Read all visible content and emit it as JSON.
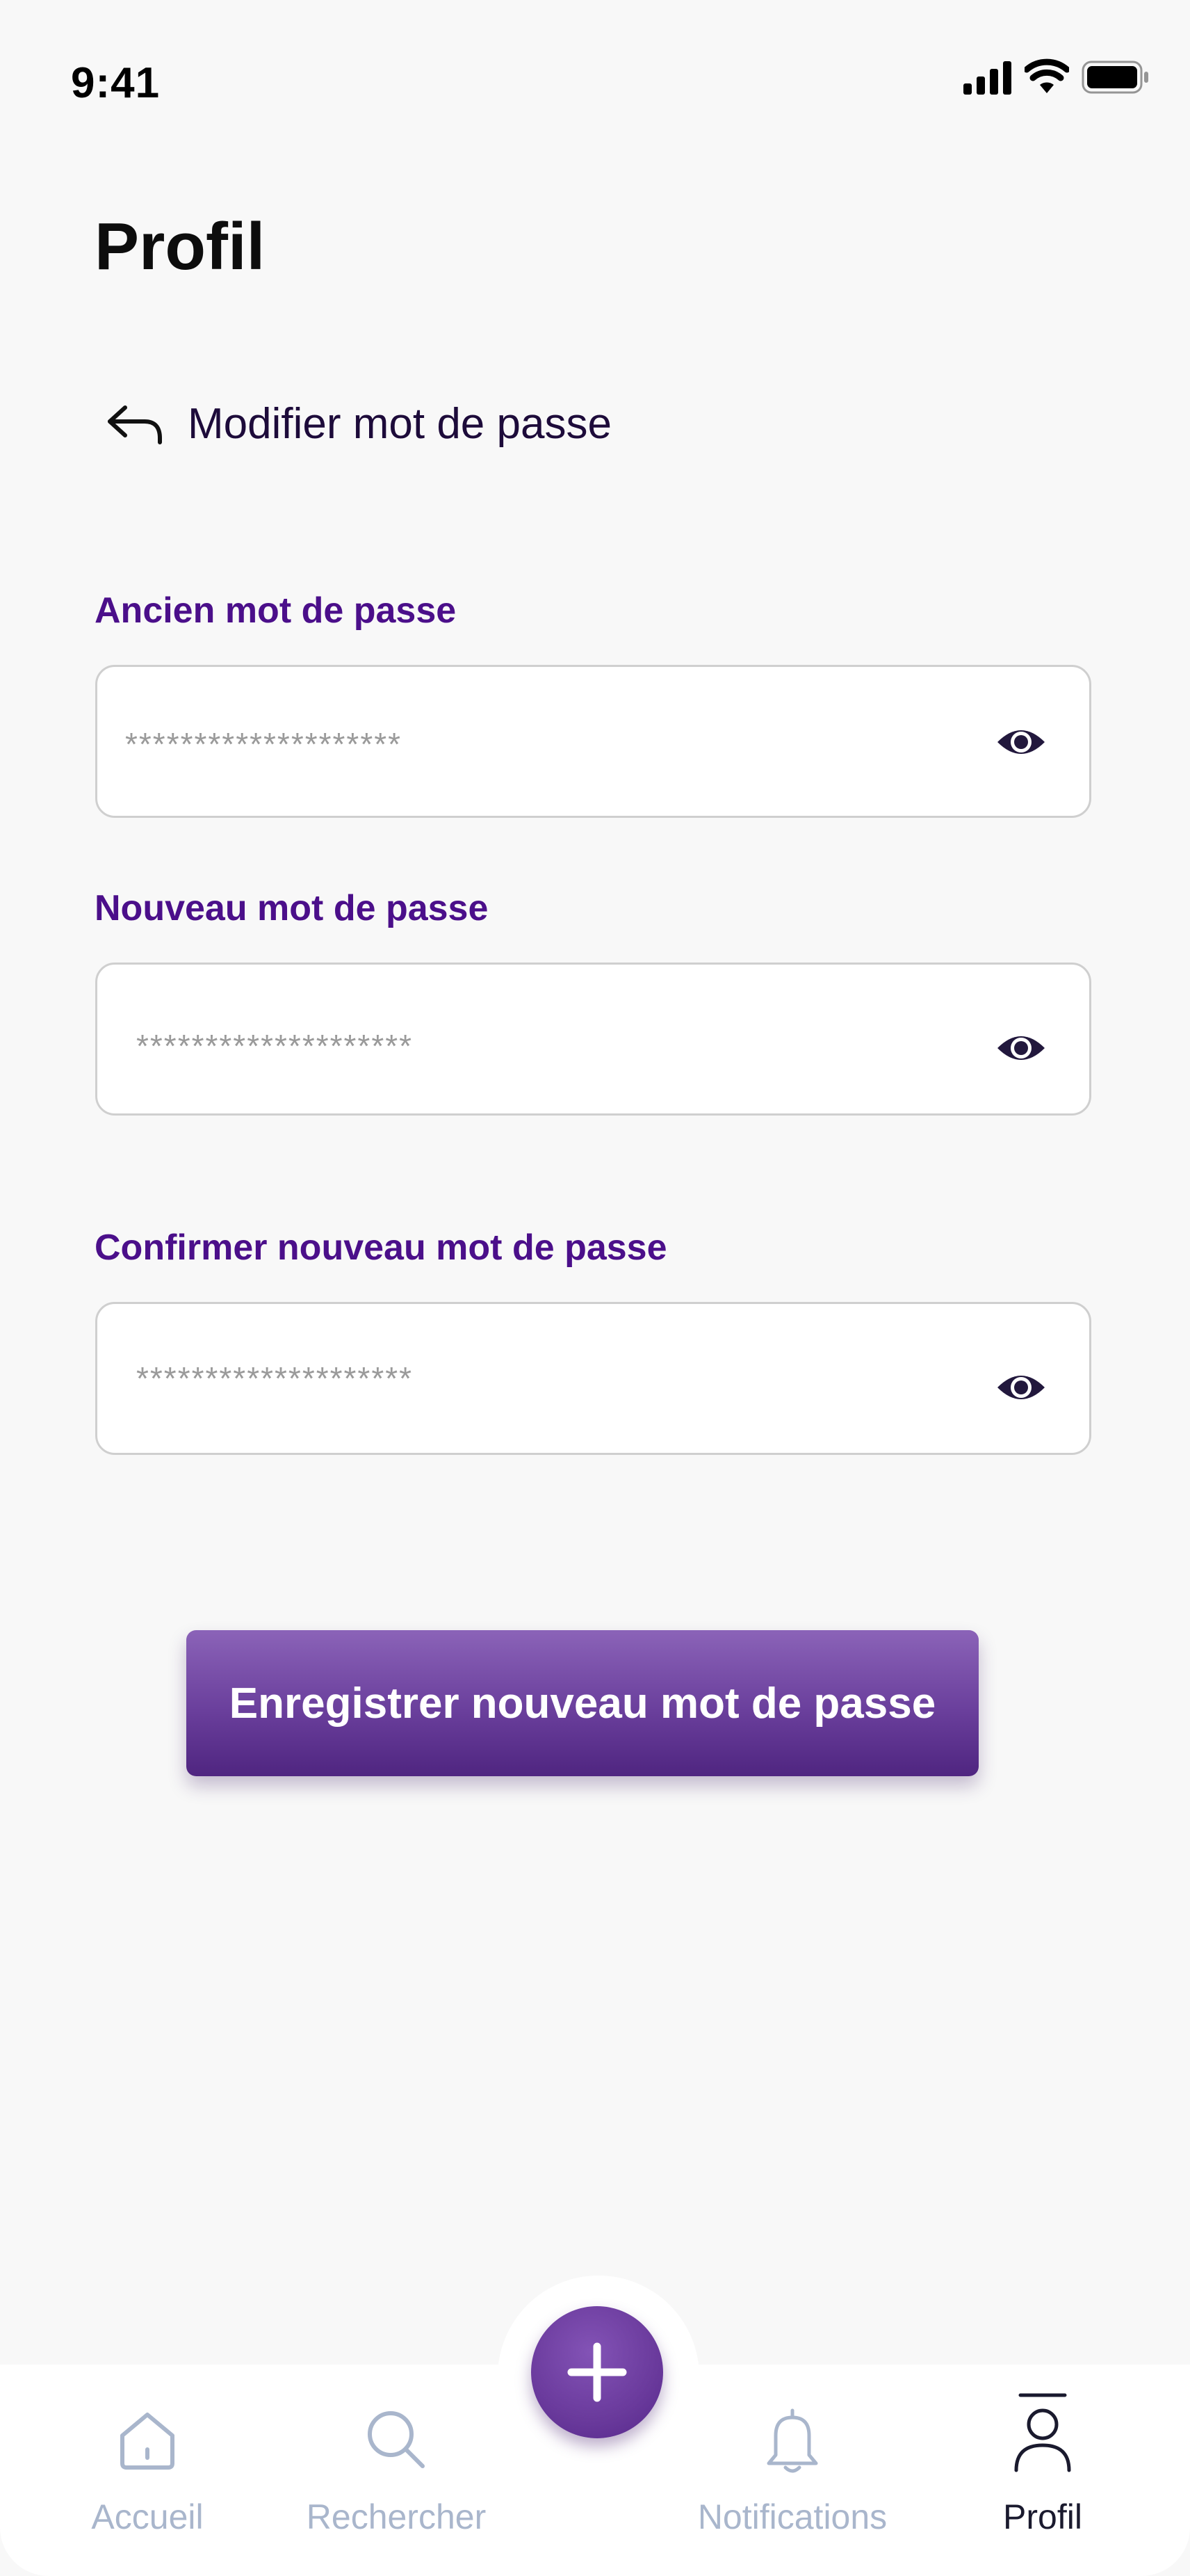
{
  "status_bar": {
    "time": "9:41",
    "icons": [
      "cellular-signal-icon",
      "wifi-icon",
      "battery-icon"
    ]
  },
  "header": {
    "title": "Profil"
  },
  "back": {
    "label": "Modifier mot de passe",
    "icon": "back-arrow-icon"
  },
  "form": {
    "fields": [
      {
        "label": "Ancien mot de passe",
        "value": "********************",
        "icon": "eye-icon"
      },
      {
        "label": "Nouveau mot de passe",
        "value": "********************",
        "icon": "eye-icon"
      },
      {
        "label": "Confirmer nouveau mot de passe",
        "value": "********************",
        "icon": "eye-icon"
      }
    ],
    "submit_label": "Enregistrer nouveau mot de passe"
  },
  "bottom_nav": {
    "items": [
      {
        "label": "Accueil",
        "icon": "home-icon",
        "active": false
      },
      {
        "label": "Rechercher",
        "icon": "search-icon",
        "active": false
      },
      {
        "label": "Notifications",
        "icon": "bell-icon",
        "active": false
      },
      {
        "label": "Profil",
        "icon": "user-icon",
        "active": true
      }
    ],
    "fab_icon": "plus-icon"
  },
  "colors": {
    "accent": "#4b0f8a",
    "button_gradient_top": "#8b63b8",
    "button_gradient_bottom": "#4f2580",
    "nav_inactive": "#a9b6cc",
    "nav_active": "#1a1a2e"
  }
}
